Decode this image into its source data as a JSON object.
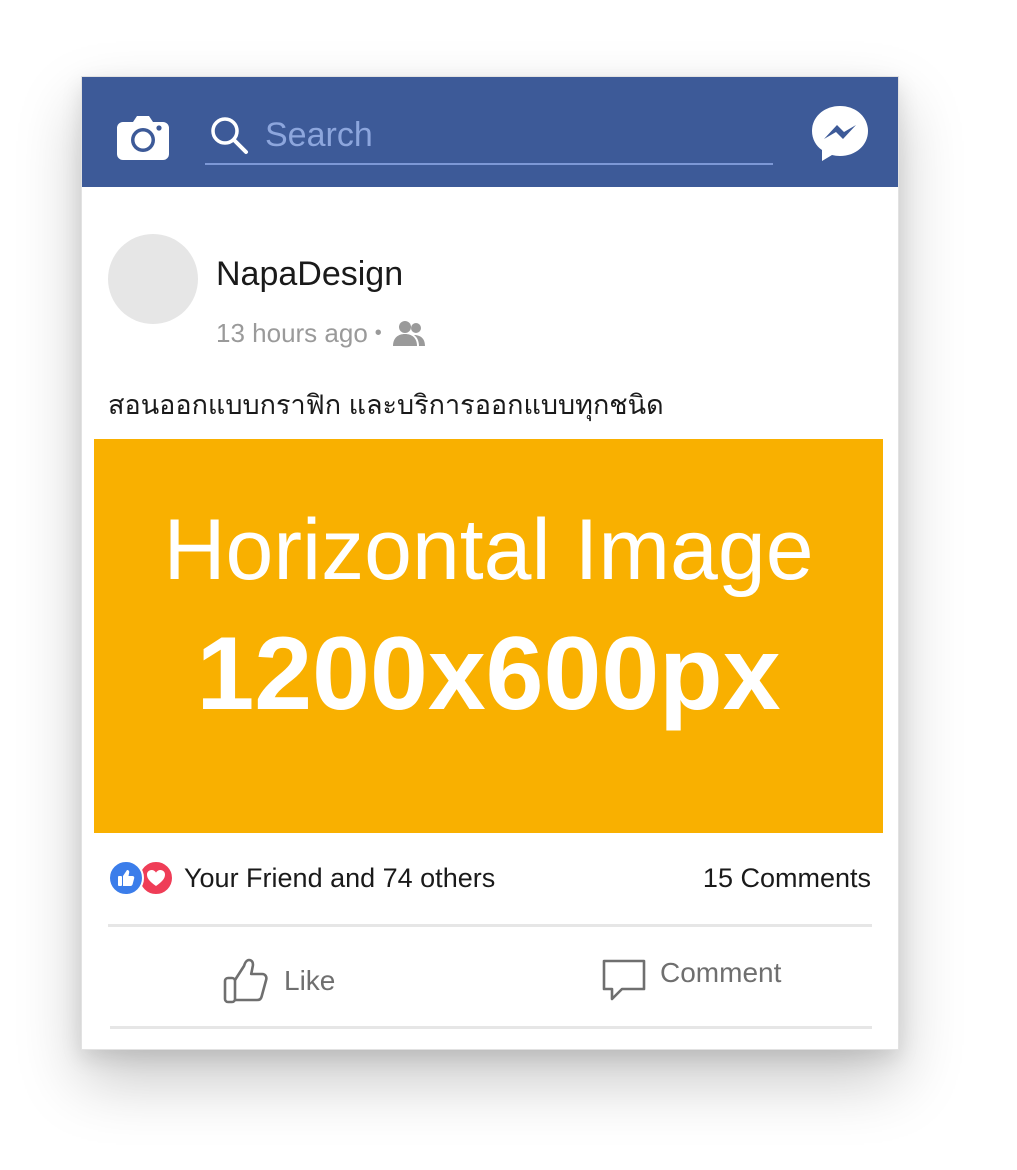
{
  "topbar": {
    "background": "#3d5a98",
    "camera_icon": "camera-icon",
    "search_icon": "search-icon",
    "search_placeholder": "Search",
    "search_value": "",
    "messenger_icon": "messenger-icon"
  },
  "post": {
    "author": "NapaDesign",
    "time": "13 hours ago",
    "separator": "•",
    "audience_icon": "friends-icon",
    "text": "สอนออกแบบกราฟิก และบริการออกแบบทุกชนิด",
    "image": {
      "background": "#f9b000",
      "line1": "Horizontal Image",
      "line2": "1200x600px"
    },
    "reactions": {
      "like_icon": "like-reaction-icon",
      "love_icon": "love-reaction-icon",
      "text": "Your Friend and 74 others"
    },
    "comments_count": "15 Comments"
  },
  "actions": {
    "like_label": "Like",
    "comment_label": "Comment"
  }
}
